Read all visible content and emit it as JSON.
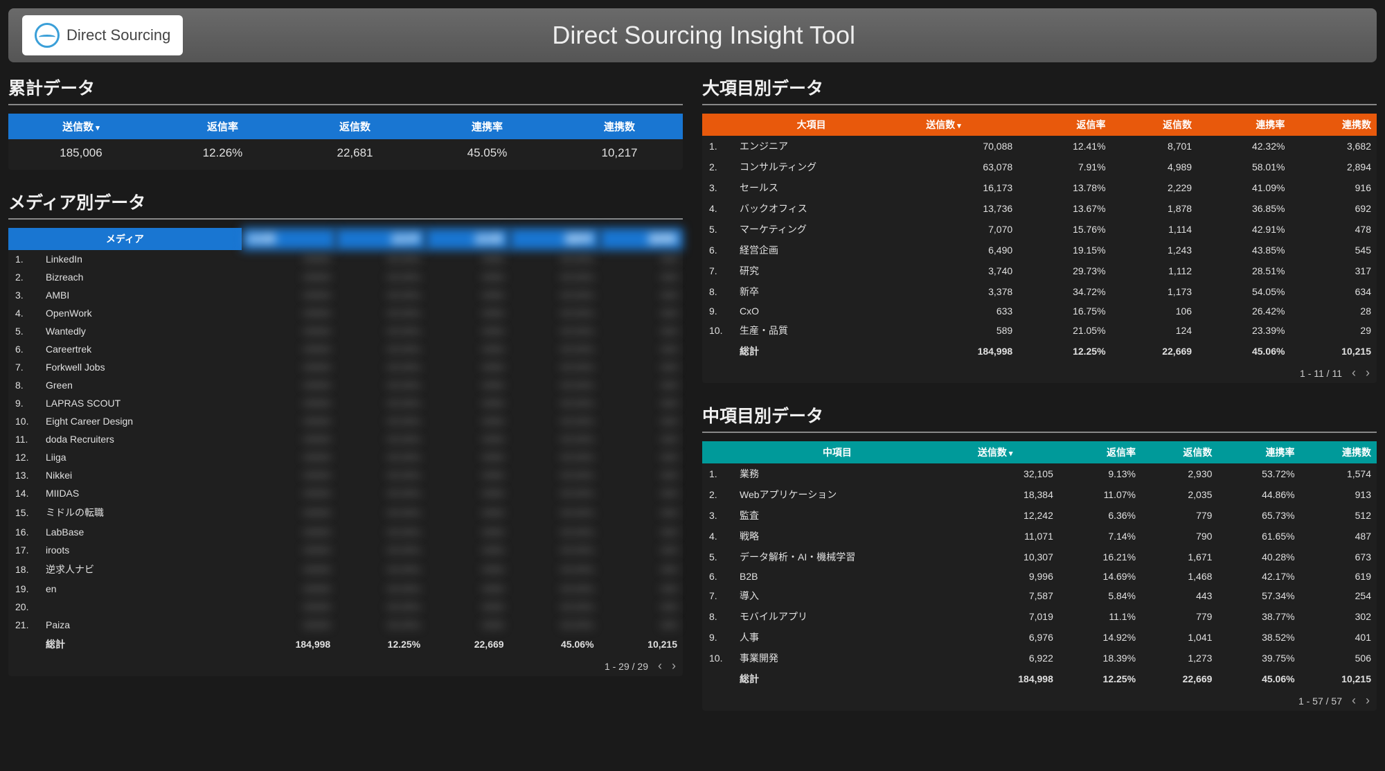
{
  "header": {
    "logo_text": "Direct Sourcing",
    "app_title": "Direct Sourcing Insight Tool"
  },
  "summary": {
    "title": "累計データ",
    "headers": [
      "送信数",
      "返信率",
      "返信数",
      "連携率",
      "連携数"
    ],
    "values": [
      "185,006",
      "12.26%",
      "22,681",
      "45.05%",
      "10,217"
    ]
  },
  "media": {
    "title": "メディア別データ",
    "headers": [
      "メディア",
      "送信数",
      "返信率",
      "返信数",
      "連携率",
      "連携数"
    ],
    "rows": [
      {
        "idx": "1.",
        "name": "LinkedIn"
      },
      {
        "idx": "2.",
        "name": "Bizreach"
      },
      {
        "idx": "3.",
        "name": "AMBI"
      },
      {
        "idx": "4.",
        "name": "OpenWork"
      },
      {
        "idx": "5.",
        "name": "Wantedly"
      },
      {
        "idx": "6.",
        "name": "Careertrek"
      },
      {
        "idx": "7.",
        "name": "Forkwell Jobs"
      },
      {
        "idx": "8.",
        "name": "Green"
      },
      {
        "idx": "9.",
        "name": "LAPRAS SCOUT"
      },
      {
        "idx": "10.",
        "name": "Eight Career Design"
      },
      {
        "idx": "11.",
        "name": "doda Recruiters"
      },
      {
        "idx": "12.",
        "name": "Liiga"
      },
      {
        "idx": "13.",
        "name": "Nikkei"
      },
      {
        "idx": "14.",
        "name": "MIIDAS"
      },
      {
        "idx": "15.",
        "name": "ミドルの転職"
      },
      {
        "idx": "16.",
        "name": "LabBase"
      },
      {
        "idx": "17.",
        "name": "iroots"
      },
      {
        "idx": "18.",
        "name": "逆求人ナビ"
      },
      {
        "idx": "19.",
        "name": "en"
      },
      {
        "idx": "20.",
        "name": ""
      },
      {
        "idx": "21.",
        "name": "Paiza"
      }
    ],
    "total": {
      "label": "総計",
      "c1": "184,998",
      "c2": "12.25%",
      "c3": "22,669",
      "c4": "45.06%",
      "c5": "10,215"
    },
    "pager": "1 - 29 / 29"
  },
  "major": {
    "title": "大項目別データ",
    "headers": [
      "大項目",
      "送信数",
      "返信率",
      "返信数",
      "連携率",
      "連携数"
    ],
    "rows": [
      {
        "idx": "1.",
        "name": "エンジニア",
        "c1": "70,088",
        "c2": "12.41%",
        "c3": "8,701",
        "c4": "42.32%",
        "c5": "3,682"
      },
      {
        "idx": "2.",
        "name": "コンサルティング",
        "c1": "63,078",
        "c2": "7.91%",
        "c3": "4,989",
        "c4": "58.01%",
        "c5": "2,894"
      },
      {
        "idx": "3.",
        "name": "セールス",
        "c1": "16,173",
        "c2": "13.78%",
        "c3": "2,229",
        "c4": "41.09%",
        "c5": "916"
      },
      {
        "idx": "4.",
        "name": "バックオフィス",
        "c1": "13,736",
        "c2": "13.67%",
        "c3": "1,878",
        "c4": "36.85%",
        "c5": "692"
      },
      {
        "idx": "5.",
        "name": "マーケティング",
        "c1": "7,070",
        "c2": "15.76%",
        "c3": "1,114",
        "c4": "42.91%",
        "c5": "478"
      },
      {
        "idx": "6.",
        "name": "経営企画",
        "c1": "6,490",
        "c2": "19.15%",
        "c3": "1,243",
        "c4": "43.85%",
        "c5": "545"
      },
      {
        "idx": "7.",
        "name": "研究",
        "c1": "3,740",
        "c2": "29.73%",
        "c3": "1,112",
        "c4": "28.51%",
        "c5": "317"
      },
      {
        "idx": "8.",
        "name": "新卒",
        "c1": "3,378",
        "c2": "34.72%",
        "c3": "1,173",
        "c4": "54.05%",
        "c5": "634"
      },
      {
        "idx": "9.",
        "name": "CxO",
        "c1": "633",
        "c2": "16.75%",
        "c3": "106",
        "c4": "26.42%",
        "c5": "28"
      },
      {
        "idx": "10.",
        "name": "生産・品質",
        "c1": "589",
        "c2": "21.05%",
        "c3": "124",
        "c4": "23.39%",
        "c5": "29"
      }
    ],
    "total": {
      "label": "総計",
      "c1": "184,998",
      "c2": "12.25%",
      "c3": "22,669",
      "c4": "45.06%",
      "c5": "10,215"
    },
    "pager": "1 - 11 / 11"
  },
  "minor": {
    "title": "中項目別データ",
    "headers": [
      "中項目",
      "送信数",
      "返信率",
      "返信数",
      "連携率",
      "連携数"
    ],
    "rows": [
      {
        "idx": "1.",
        "name": "業務",
        "c1": "32,105",
        "c2": "9.13%",
        "c3": "2,930",
        "c4": "53.72%",
        "c5": "1,574"
      },
      {
        "idx": "2.",
        "name": "Webアプリケーション",
        "c1": "18,384",
        "c2": "11.07%",
        "c3": "2,035",
        "c4": "44.86%",
        "c5": "913"
      },
      {
        "idx": "3.",
        "name": "監査",
        "c1": "12,242",
        "c2": "6.36%",
        "c3": "779",
        "c4": "65.73%",
        "c5": "512"
      },
      {
        "idx": "4.",
        "name": "戦略",
        "c1": "11,071",
        "c2": "7.14%",
        "c3": "790",
        "c4": "61.65%",
        "c5": "487"
      },
      {
        "idx": "5.",
        "name": "データ解析・AI・機械学習",
        "c1": "10,307",
        "c2": "16.21%",
        "c3": "1,671",
        "c4": "40.28%",
        "c5": "673"
      },
      {
        "idx": "6.",
        "name": "B2B",
        "c1": "9,996",
        "c2": "14.69%",
        "c3": "1,468",
        "c4": "42.17%",
        "c5": "619"
      },
      {
        "idx": "7.",
        "name": "導入",
        "c1": "7,587",
        "c2": "5.84%",
        "c3": "443",
        "c4": "57.34%",
        "c5": "254"
      },
      {
        "idx": "8.",
        "name": "モバイルアプリ",
        "c1": "7,019",
        "c2": "11.1%",
        "c3": "779",
        "c4": "38.77%",
        "c5": "302"
      },
      {
        "idx": "9.",
        "name": "人事",
        "c1": "6,976",
        "c2": "14.92%",
        "c3": "1,041",
        "c4": "38.52%",
        "c5": "401"
      },
      {
        "idx": "10.",
        "name": "事業開発",
        "c1": "6,922",
        "c2": "18.39%",
        "c3": "1,273",
        "c4": "39.75%",
        "c5": "506"
      }
    ],
    "total": {
      "label": "総計",
      "c1": "184,998",
      "c2": "12.25%",
      "c3": "22,669",
      "c4": "45.06%",
      "c5": "10,215"
    },
    "pager": "1 - 57 / 57"
  }
}
